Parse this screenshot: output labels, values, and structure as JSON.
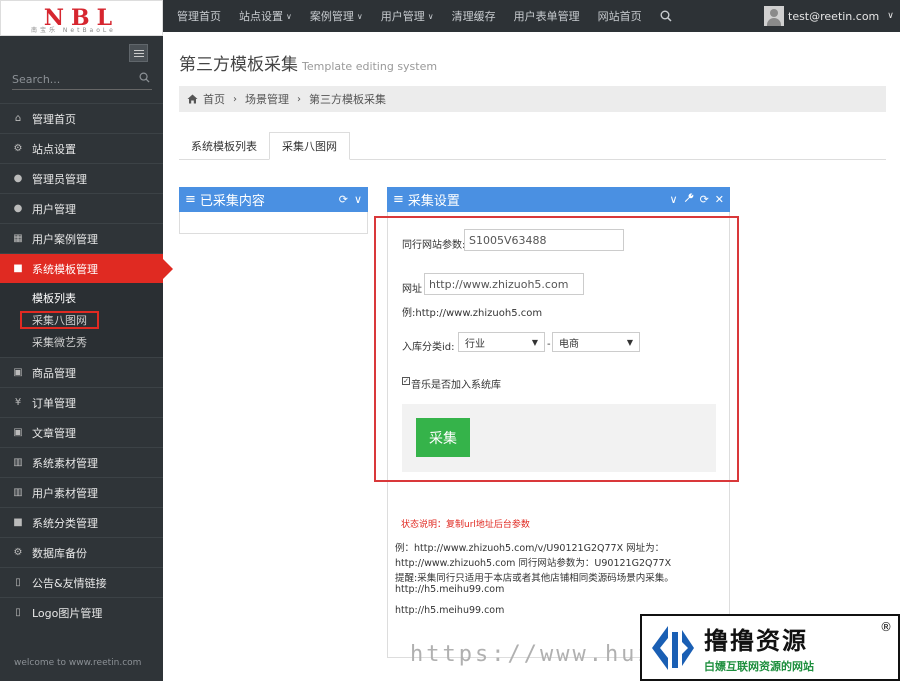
{
  "logo": {
    "text": "NBL",
    "subtitle": "南宝乐 NetBaoLe"
  },
  "topnav": {
    "items": [
      {
        "label": "管理首页",
        "dropdown": false
      },
      {
        "label": "站点设置",
        "dropdown": true
      },
      {
        "label": "案例管理",
        "dropdown": true
      },
      {
        "label": "用户管理",
        "dropdown": true
      },
      {
        "label": "清理缓存",
        "dropdown": false
      },
      {
        "label": "用户表单管理",
        "dropdown": false
      },
      {
        "label": "网站首页",
        "dropdown": false
      }
    ],
    "caret": "∨",
    "user_email": "test@reetin.com"
  },
  "sidebar": {
    "search_placeholder": "Search...",
    "items": [
      {
        "label": "管理首页",
        "icon": "home-icon",
        "glyph": "⌂"
      },
      {
        "label": "站点设置",
        "icon": "gears-icon",
        "glyph": "⚙"
      },
      {
        "label": "管理员管理",
        "icon": "user-icon",
        "glyph": "●"
      },
      {
        "label": "用户管理",
        "icon": "user-icon",
        "glyph": "●"
      },
      {
        "label": "用户案例管理",
        "icon": "table-icon",
        "glyph": "▦"
      },
      {
        "label": "系统模板管理",
        "icon": "briefcase-icon",
        "glyph": "■",
        "active": true
      },
      {
        "label": "商品管理",
        "icon": "caret-square-icon",
        "glyph": "▣"
      },
      {
        "label": "订单管理",
        "icon": "yen-icon",
        "glyph": "¥"
      },
      {
        "label": "文章管理",
        "icon": "caret-square-icon",
        "glyph": "▣"
      },
      {
        "label": "系统素材管理",
        "icon": "gift-icon",
        "glyph": "▥"
      },
      {
        "label": "用户素材管理",
        "icon": "gift-icon",
        "glyph": "▥"
      },
      {
        "label": "系统分类管理",
        "icon": "briefcase-icon",
        "glyph": "■"
      },
      {
        "label": "数据库备份",
        "icon": "gears-icon",
        "glyph": "⚙"
      },
      {
        "label": "公告&友情链接",
        "icon": "bookmark-icon",
        "glyph": "▯"
      },
      {
        "label": "Logo图片管理",
        "icon": "bookmark-icon",
        "glyph": "▯"
      }
    ],
    "subitems": [
      "模板列表",
      "采集八图网",
      "采集微艺秀"
    ],
    "welcome": "welcome to www.reetin.com"
  },
  "page": {
    "title": "第三方模板采集",
    "title_en": "Template editing system",
    "breadcrumb": [
      "首页",
      "场景管理",
      "第三方模板采集"
    ],
    "breadcrumb_sep": "›",
    "tabs": [
      "系统模板列表",
      "采集八图网"
    ]
  },
  "left_panel": {
    "title": "已采集内容",
    "glyph": "≡",
    "tools": [
      "⟳",
      "∨"
    ]
  },
  "right_panel": {
    "title": "采集设置",
    "glyph": "≡",
    "tools": [
      "∨",
      "🔧",
      "⟳",
      "✕"
    ],
    "form": {
      "param_label": "同行网站参数:",
      "param_value": "S1005V63488",
      "url_label": "网址",
      "url_value": "http://www.zhizuoh5.com",
      "url_example": "例:http://www.zhizuoh5.com",
      "category_label": "入库分类id:",
      "category_select1": "行业",
      "category_dash": "-",
      "category_select2": "电商",
      "checkbox_label": "音乐是否加入系统库",
      "checkbox_checked": true,
      "collect_button": "采集"
    },
    "status_label": "状态说明：复制url地址后台参数",
    "notes": [
      "例：http://www.zhizuoh5.com/v/U90121G2Q77X 网址为：",
      "http://www.zhizuoh5.com 同行网站参数为：U90121G2Q77X",
      "提醒:采集同行只适用于本店或者其他店铺相同类源码场景内采集。",
      "http://h5.meihu99.com",
      "http://h5.meihu99.com"
    ]
  },
  "watermark": {
    "url": "https://www.huzha",
    "brand_name": "撸撸资源",
    "brand_reg": "®",
    "brand_slogan": "白嫖互联网资源的网站"
  }
}
